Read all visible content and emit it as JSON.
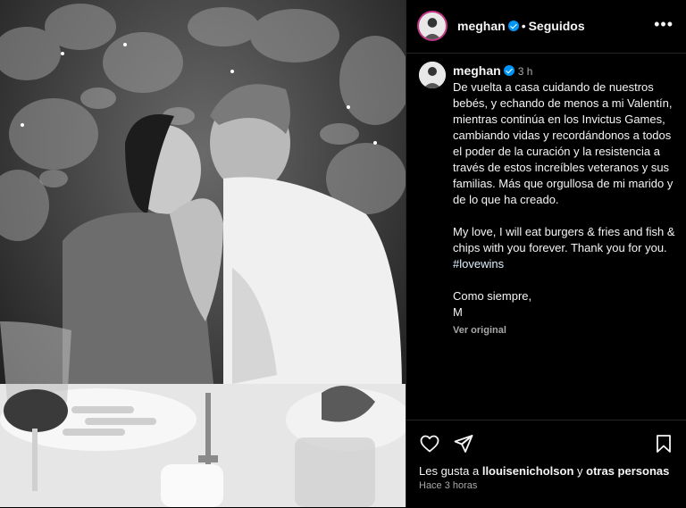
{
  "post": {
    "username": "meghan",
    "follow_status": "Seguidos",
    "more_label": "•••",
    "photo_icon": "photo-scene-couple-kiss"
  },
  "caption": {
    "username": "meghan",
    "time": "3 h",
    "paragraph1": "De vuelta a casa cuidando de nuestros bebés, y echando de menos a mi Valentín, mientras continúa en los Invictus Games, cambiando vidas y recordándonos a todos el poder de la curación y la resistencia a través de estos increíbles veteranos y sus familias. Más que orgullosa de mi marido y de lo que ha creado.",
    "paragraph2": "My love, I will eat burgers & fries and fish & chips with you forever. Thank you for you.",
    "hashtag": "#lovewins",
    "signoff1": "Como siempre,",
    "signoff2": "M",
    "see_original": "Ver original"
  },
  "actions": {
    "icons": [
      "heart-icon",
      "share-icon",
      "bookmark-icon"
    ]
  },
  "likes": {
    "prefix": "Les gusta a ",
    "user": "llouisenicholson",
    "connector": " y ",
    "others": "otras personas"
  },
  "time_ago": "Hace 3 horas",
  "colors": {
    "accent": "#0095f6",
    "ring": "#c13584",
    "background": "#000000"
  }
}
